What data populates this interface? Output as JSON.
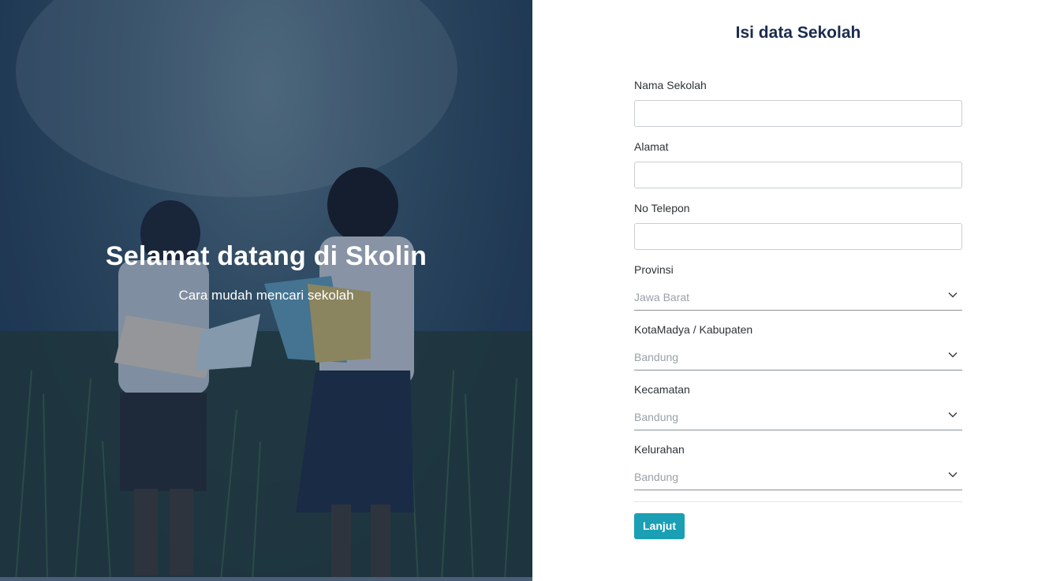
{
  "hero": {
    "title": "Selamat datang di Skolin",
    "subtitle": "Cara mudah mencari sekolah"
  },
  "form": {
    "title": "Isi data Sekolah",
    "fields": {
      "nama_sekolah": {
        "label": "Nama Sekolah",
        "value": ""
      },
      "alamat": {
        "label": "Alamat",
        "value": ""
      },
      "no_telepon": {
        "label": "No Telepon",
        "value": ""
      }
    },
    "selects": {
      "provinsi": {
        "label": "Provinsi",
        "value": "Jawa Barat"
      },
      "kotamadya": {
        "label": "KotaMadya / Kabupaten",
        "value": "Bandung"
      },
      "kecamatan": {
        "label": "Kecamatan",
        "value": "Bandung"
      },
      "kelurahan": {
        "label": "Kelurahan",
        "value": "Bandung"
      }
    },
    "submit_label": "Lanjut"
  },
  "colors": {
    "accent": "#1a9fb4",
    "title": "#1a2c4e",
    "hero_overlay": "#162c4a"
  },
  "icons": {
    "select_chevron": "chevron-down-icon"
  }
}
